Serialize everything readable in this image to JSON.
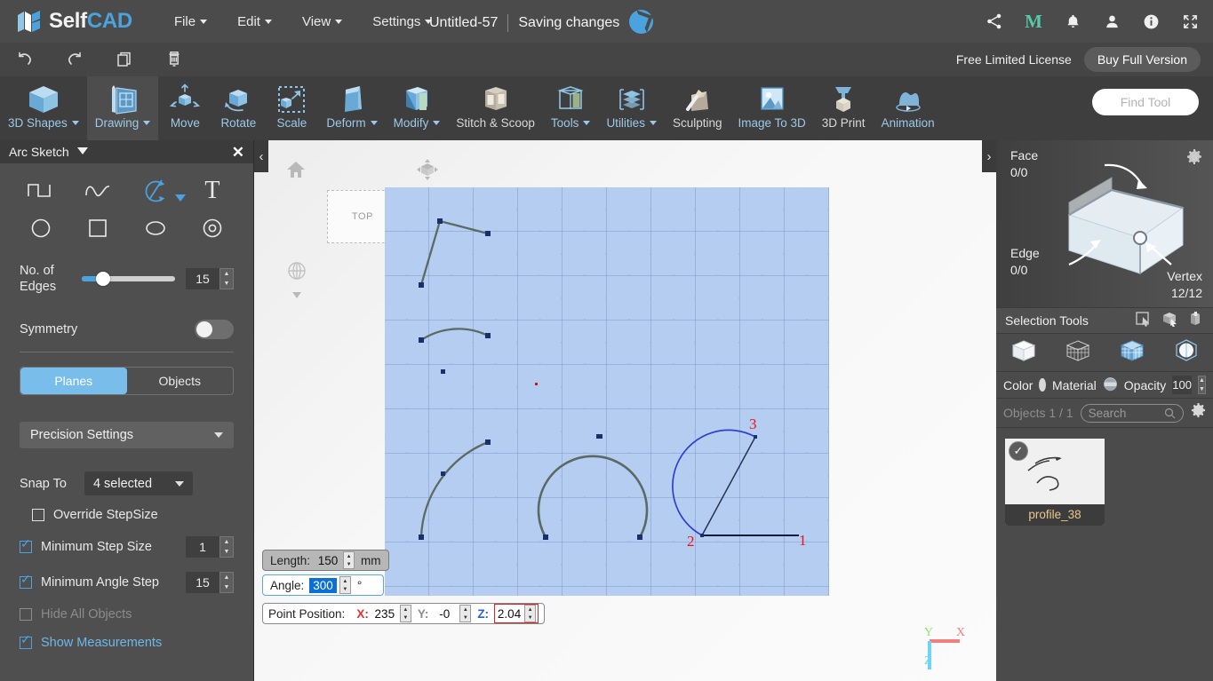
{
  "app": {
    "brand_self": "Self",
    "brand_cad": "CAD",
    "menus": [
      "File",
      "Edit",
      "View",
      "Settings"
    ],
    "document_title": "Untitled-57",
    "save_status": "Saving changes",
    "top_icons": [
      "share-icon",
      "magic-m-icon",
      "bell-icon",
      "user-icon",
      "info-icon",
      "fullscreen-icon"
    ],
    "license_text": "Free Limited License",
    "buy_button": "Buy Full Version"
  },
  "quickbar": {
    "items": [
      "undo-icon",
      "redo-icon",
      "copy-icon",
      "delete-icon"
    ]
  },
  "ribbon": {
    "items": [
      {
        "label": "3D Shapes",
        "dropdown": true,
        "icon": "cube-icon",
        "active": false
      },
      {
        "label": "Drawing",
        "dropdown": true,
        "icon": "drawing-icon",
        "active": true
      },
      {
        "label": "Move",
        "dropdown": false,
        "icon": "move-icon",
        "active": false
      },
      {
        "label": "Rotate",
        "dropdown": false,
        "icon": "rotate-icon",
        "active": false
      },
      {
        "label": "Scale",
        "dropdown": false,
        "icon": "scale-icon",
        "active": false
      },
      {
        "label": "Deform",
        "dropdown": true,
        "icon": "deform-icon",
        "active": false
      },
      {
        "label": "Modify",
        "dropdown": true,
        "icon": "modify-icon",
        "active": false
      },
      {
        "label": "Stitch & Scoop",
        "dropdown": false,
        "icon": "stitch-scoop-icon",
        "active": false
      },
      {
        "label": "Tools",
        "dropdown": true,
        "icon": "tools-icon",
        "active": false
      },
      {
        "label": "Utilities",
        "dropdown": true,
        "icon": "utilities-icon",
        "active": false
      },
      {
        "label": "Sculpting",
        "dropdown": false,
        "icon": "sculpting-icon",
        "active": false
      },
      {
        "label": "Image To 3D",
        "dropdown": false,
        "icon": "image-to-3d-icon",
        "active": false
      },
      {
        "label": "3D Print",
        "dropdown": false,
        "icon": "3d-print-icon",
        "active": false
      },
      {
        "label": "Animation",
        "dropdown": false,
        "icon": "animation-icon",
        "active": false
      }
    ],
    "find_tool_placeholder": "Find Tool"
  },
  "left_panel": {
    "title": "Arc Sketch",
    "tools": [
      {
        "name": "polyline-tool",
        "selected": false
      },
      {
        "name": "freehand-tool",
        "selected": false
      },
      {
        "name": "arc-tool",
        "selected": true
      },
      {
        "name": "text-tool",
        "selected": false
      },
      {
        "name": "circle-tool",
        "selected": false
      },
      {
        "name": "rectangle-tool",
        "selected": false
      },
      {
        "name": "ellipse-tool",
        "selected": false
      },
      {
        "name": "ring-tool",
        "selected": false
      }
    ],
    "edges_label": "No. of Edges",
    "edges_value": "15",
    "symmetry_label": "Symmetry",
    "symmetry_on": false,
    "tabs": [
      {
        "label": "Planes",
        "active": true
      },
      {
        "label": "Objects",
        "active": false
      }
    ],
    "precision_settings_label": "Precision Settings",
    "snap_to_label": "Snap To",
    "snap_to_value": "4 selected",
    "override_stepsize_label": "Override StepSize",
    "override_stepsize_checked": false,
    "min_step_size_label": "Minimum Step Size",
    "min_step_size_value": "1",
    "min_step_size_checked": true,
    "min_angle_step_label": "Minimum Angle Step",
    "min_angle_step_value": "15",
    "min_angle_step_checked": true,
    "hide_all_objects_label": "Hide All Objects",
    "hide_all_objects_checked": false,
    "show_measurements_label": "Show Measurements",
    "show_measurements_checked": true
  },
  "viewport": {
    "plane_label": "TOP",
    "axis": {
      "x": "X",
      "y": "Y",
      "z": "Z"
    },
    "colors": {
      "grid_fill": "#b6cdf2",
      "grid_line": "#7f97c9",
      "sketch_stroke": "#5a6b63",
      "active_arc": "#2f3ed1",
      "point_label": "#ee1111"
    },
    "arc_point_labels": [
      "1",
      "2",
      "3"
    ]
  },
  "measurements": {
    "length_label": "Length:",
    "length_value": "150",
    "length_unit": "mm",
    "angle_label": "Angle:",
    "angle_value": "300",
    "angle_unit": "°",
    "point_position_label": "Point Position:",
    "x_label": "X:",
    "x_value": "235",
    "y_label": "Y:",
    "y_value": "-0",
    "z_label": "Z:",
    "z_value": "2.04"
  },
  "right_panel": {
    "face_label": "Face",
    "face_value": "0/0",
    "edge_label": "Edge",
    "edge_value": "0/0",
    "vertex_label": "Vertex",
    "vertex_value": "12/12",
    "selection_tools_label": "Selection Tools",
    "selection_icons": [
      "rect-select-icon",
      "box-select-icon",
      "paint-select-icon"
    ],
    "mode_icons": [
      "object-mode-icon",
      "vertex-mode-icon",
      "face-mode-icon",
      "edge-mode-icon"
    ],
    "color_label": "Color",
    "material_label": "Material",
    "opacity_label": "Opacity",
    "opacity_value": "100",
    "objects_count_label": "Objects 1 / 1",
    "search_placeholder": "Search",
    "objects": [
      {
        "name": "profile_38",
        "selected": true
      }
    ]
  }
}
